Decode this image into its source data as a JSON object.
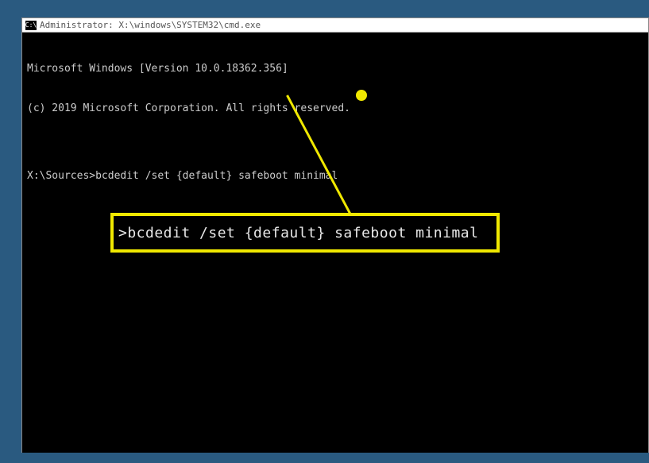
{
  "titlebar": {
    "icon_text": "C:\\",
    "title": "Administrator: X:\\windows\\SYSTEM32\\cmd.exe"
  },
  "terminal": {
    "line1": "Microsoft Windows [Version 10.0.18362.356]",
    "line2": "(c) 2019 Microsoft Corporation. All rights reserved.",
    "blank": "",
    "prompt": "X:\\Sources>",
    "command": "bcdedit /set {default} safeboot minimal"
  },
  "callout": {
    "text": ">bcdedit /set {default} safeboot minimal"
  }
}
